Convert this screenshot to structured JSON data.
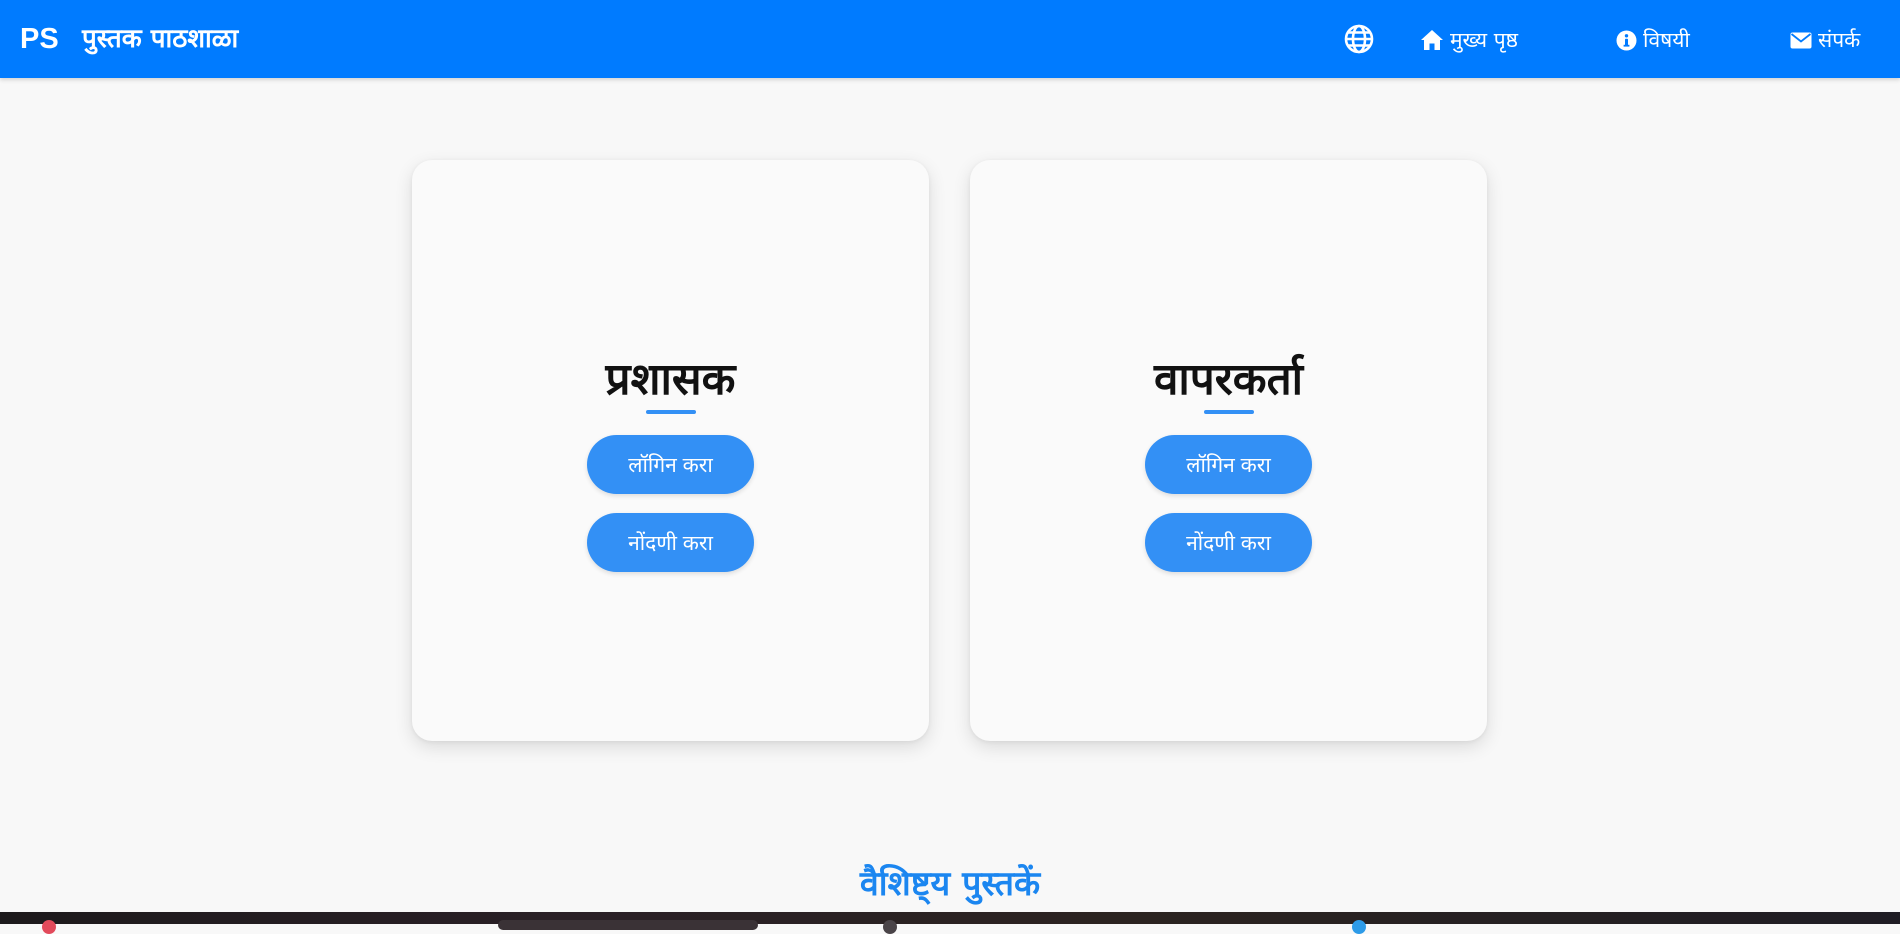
{
  "navbar": {
    "logo": "PS",
    "brand": "पुस्तक पाठशाळा",
    "links": {
      "home": "मुख्य पृष्ठ",
      "about": "विषयी",
      "contact": "संपर्क"
    }
  },
  "cards": {
    "admin": {
      "title": "प्रशासक",
      "login_label": "लॉगिन करा",
      "register_label": "नोंदणी करा"
    },
    "user": {
      "title": "वापरकर्ता",
      "login_label": "लॉगिन करा",
      "register_label": "नोंदणी करा"
    }
  },
  "featured": {
    "heading": "वैशिष्ट्य पुस्तकें"
  },
  "colors": {
    "navbar_bg": "#007bff",
    "button_bg": "#3390f5",
    "featured_heading": "#1b86f0",
    "page_bg": "#f8f8f8"
  },
  "icons": {
    "language": "globe-icon",
    "home": "home-icon",
    "about": "info-icon",
    "contact": "envelope-icon"
  }
}
